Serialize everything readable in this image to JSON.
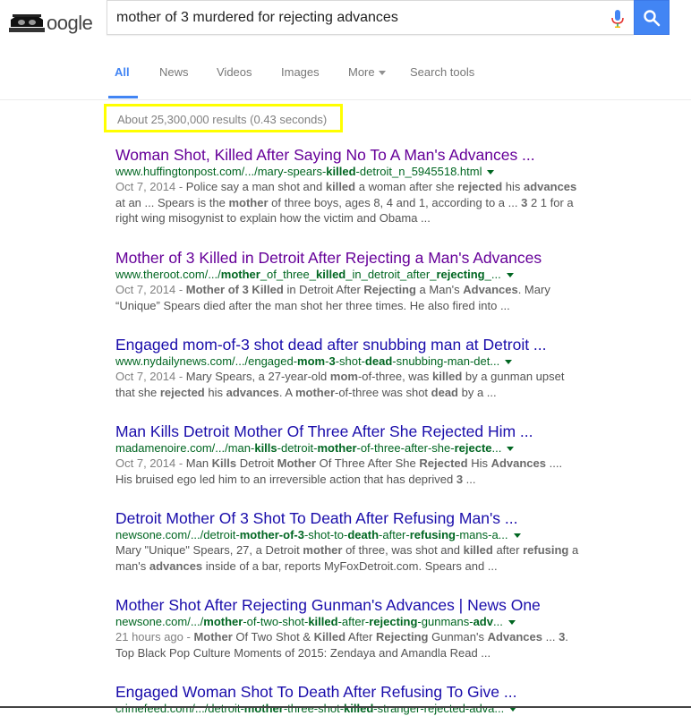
{
  "header": {
    "logo_text": "oogle",
    "query": "mother of 3 murdered for rejecting advances"
  },
  "tabs": [
    {
      "label": "All",
      "active": true
    },
    {
      "label": "News"
    },
    {
      "label": "Videos"
    },
    {
      "label": "Images"
    },
    {
      "label": "More"
    },
    {
      "label": "Search tools"
    }
  ],
  "stats": "About 25,300,000 results (0.43 seconds)",
  "results": [
    {
      "title": "Woman Shot, Killed After Saying No To A Man's Advances ...",
      "visited": true,
      "url_parts": [
        [
          "www.huffingtonpost.com/.../mary-spears-",
          false
        ],
        [
          "killed",
          true
        ],
        [
          "-detroit_n_5945518.html",
          false
        ]
      ],
      "date": "Oct 7, 2014 - ",
      "snippet_parts": [
        [
          "Police say a man shot and ",
          false
        ],
        [
          "killed",
          true
        ],
        [
          " a woman after she ",
          false
        ],
        [
          "rejected",
          true
        ],
        [
          " his ",
          false
        ],
        [
          "advances",
          true
        ],
        [
          " at an ... Spears is the ",
          false
        ],
        [
          "mother",
          true
        ],
        [
          " of three boys, ages 8, 4 and 1, according to a ... ",
          false
        ],
        [
          "3",
          true
        ],
        [
          " 2 1 for a right wing misogynist to explain how the victim and Obama  ...",
          false
        ]
      ]
    },
    {
      "title": "Mother of 3 Killed in Detroit After Rejecting a Man's Advances",
      "visited": true,
      "url_parts": [
        [
          "www.theroot.com/.../",
          false
        ],
        [
          "mother",
          true
        ],
        [
          "_of_three_",
          false
        ],
        [
          "killed",
          true
        ],
        [
          "_in_detroit_after_",
          false
        ],
        [
          "rejecting",
          true
        ],
        [
          "_...",
          false
        ]
      ],
      "date": "Oct 7, 2014 - ",
      "snippet_parts": [
        [
          "Mother of 3 Killed",
          true
        ],
        [
          " in Detroit After ",
          false
        ],
        [
          "Rejecting",
          true
        ],
        [
          " a Man's ",
          false
        ],
        [
          "Advances",
          true
        ],
        [
          ". Mary “Unique” Spears died after the man shot her three times. He also fired into ...",
          false
        ]
      ]
    },
    {
      "title": "Engaged mom-of-3 shot dead after snubbing man at Detroit ...",
      "visited": false,
      "url_parts": [
        [
          "www.nydailynews.com/.../engaged-",
          false
        ],
        [
          "mom",
          true
        ],
        [
          "-",
          false
        ],
        [
          "3",
          true
        ],
        [
          "-shot-",
          false
        ],
        [
          "dead",
          true
        ],
        [
          "-snubbing-man-det...",
          false
        ]
      ],
      "date": "Oct 7, 2014 - ",
      "snippet_parts": [
        [
          "Mary Spears, a 27-year-old ",
          false
        ],
        [
          "mom",
          true
        ],
        [
          "-of-three, was ",
          false
        ],
        [
          "killed",
          true
        ],
        [
          " by a gunman upset that she ",
          false
        ],
        [
          "rejected",
          true
        ],
        [
          " his ",
          false
        ],
        [
          "advances",
          true
        ],
        [
          ". A ",
          false
        ],
        [
          "mother",
          true
        ],
        [
          "-of-three was shot ",
          false
        ],
        [
          "dead",
          true
        ],
        [
          " by a  ...",
          false
        ]
      ]
    },
    {
      "title": "Man Kills Detroit Mother Of Three After She Rejected Him ...",
      "visited": false,
      "url_parts": [
        [
          "madamenoire.com/.../man-",
          false
        ],
        [
          "kills",
          true
        ],
        [
          "-detroit-",
          false
        ],
        [
          "mother",
          true
        ],
        [
          "-of-three-after-she-",
          false
        ],
        [
          "rejecte",
          true
        ],
        [
          "...",
          false
        ]
      ],
      "date": "Oct 7, 2014 - ",
      "snippet_parts": [
        [
          "Man ",
          false
        ],
        [
          "Kills",
          true
        ],
        [
          " Detroit ",
          false
        ],
        [
          "Mother",
          true
        ],
        [
          " Of Three After She ",
          false
        ],
        [
          "Rejected",
          true
        ],
        [
          " His ",
          false
        ],
        [
          "Advances",
          true
        ],
        [
          " .... His bruised ego led him to an irreversible action that has deprived ",
          false
        ],
        [
          "3",
          true
        ],
        [
          "  ...",
          false
        ]
      ]
    },
    {
      "title": "Detroit Mother Of 3 Shot To Death After Refusing Man's ...",
      "visited": false,
      "url_parts": [
        [
          "newsone.com/.../detroit-",
          false
        ],
        [
          "mother-of-3",
          true
        ],
        [
          "-shot-to-",
          false
        ],
        [
          "death",
          true
        ],
        [
          "-after-",
          false
        ],
        [
          "refusing",
          true
        ],
        [
          "-mans-a...",
          false
        ]
      ],
      "date": "",
      "snippet_parts": [
        [
          "Mary \"Unique\" Spears, 27, a Detroit ",
          false
        ],
        [
          "mother",
          true
        ],
        [
          " of three, was shot and ",
          false
        ],
        [
          "killed",
          true
        ],
        [
          " after ",
          false
        ],
        [
          "refusing",
          true
        ],
        [
          " a man's ",
          false
        ],
        [
          "advances",
          true
        ],
        [
          " inside of a bar, reports MyFoxDetroit.com. Spears and ...",
          false
        ]
      ]
    },
    {
      "title": "Mother Shot After Rejecting Gunman's Advances | News One",
      "visited": false,
      "url_parts": [
        [
          "newsone.com/.../",
          false
        ],
        [
          "mother",
          true
        ],
        [
          "-of-two-shot-",
          false
        ],
        [
          "killed",
          true
        ],
        [
          "-after-",
          false
        ],
        [
          "rejecting",
          true
        ],
        [
          "-gunmans-",
          false
        ],
        [
          "adv",
          true
        ],
        [
          "...",
          false
        ]
      ],
      "date": "21 hours ago - ",
      "snippet_parts": [
        [
          "Mother",
          true
        ],
        [
          " Of Two Shot & ",
          false
        ],
        [
          "Killed",
          true
        ],
        [
          " After ",
          false
        ],
        [
          "Rejecting",
          true
        ],
        [
          " Gunman's ",
          false
        ],
        [
          "Advances",
          true
        ],
        [
          " ... ",
          false
        ],
        [
          "3",
          true
        ],
        [
          ". Top Black Pop Culture Moments of 2015: Zendaya and Amandla Read  ...",
          false
        ]
      ]
    },
    {
      "title": "Engaged Woman Shot To Death After Refusing To Give ...",
      "visited": false,
      "url_parts": [
        [
          "crimefeed.com/.../detroit-",
          false
        ],
        [
          "mother",
          true
        ],
        [
          "-three-shot-",
          false
        ],
        [
          "killed",
          true
        ],
        [
          "-stranger-rejected-adva...",
          false
        ]
      ],
      "date": "",
      "snippet_parts": []
    }
  ]
}
